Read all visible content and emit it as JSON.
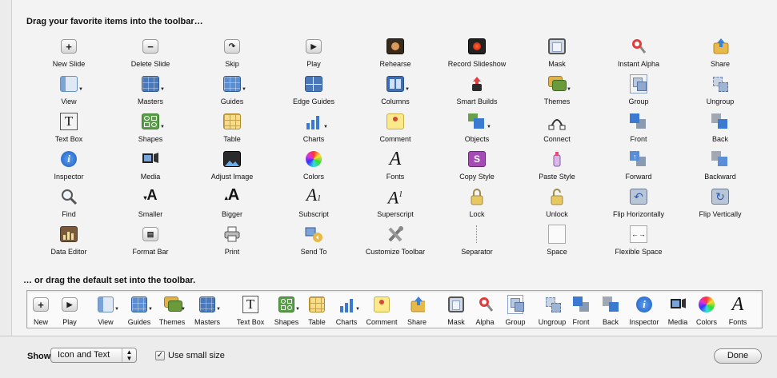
{
  "header": {
    "favorites_title": "Drag your favorite items into the toolbar…",
    "default_title": "… or drag the default set into the toolbar."
  },
  "items": [
    {
      "label": "New Slide",
      "icon": "plus-icon"
    },
    {
      "label": "Delete Slide",
      "icon": "minus-icon"
    },
    {
      "label": "Skip",
      "icon": "skip-icon"
    },
    {
      "label": "Play",
      "icon": "play-icon"
    },
    {
      "label": "Rehearse",
      "icon": "rehearse-icon"
    },
    {
      "label": "Record Slideshow",
      "icon": "record-icon"
    },
    {
      "label": "Mask",
      "icon": "mask-icon"
    },
    {
      "label": "Instant Alpha",
      "icon": "instant-alpha-icon"
    },
    {
      "label": "Share",
      "icon": "share-icon"
    },
    {
      "label": "View",
      "icon": "view-icon"
    },
    {
      "label": "Masters",
      "icon": "masters-icon"
    },
    {
      "label": "Guides",
      "icon": "guides-icon"
    },
    {
      "label": "Edge Guides",
      "icon": "edge-guides-icon"
    },
    {
      "label": "Columns",
      "icon": "columns-icon"
    },
    {
      "label": "Smart Builds",
      "icon": "smart-builds-icon"
    },
    {
      "label": "Themes",
      "icon": "themes-icon"
    },
    {
      "label": "Group",
      "icon": "group-icon"
    },
    {
      "label": "Ungroup",
      "icon": "ungroup-icon"
    },
    {
      "label": "Text Box",
      "icon": "text-box-icon"
    },
    {
      "label": "Shapes",
      "icon": "shapes-icon"
    },
    {
      "label": "Table",
      "icon": "table-icon"
    },
    {
      "label": "Charts",
      "icon": "charts-icon"
    },
    {
      "label": "Comment",
      "icon": "comment-icon"
    },
    {
      "label": "Objects",
      "icon": "objects-icon"
    },
    {
      "label": "Connect",
      "icon": "connect-icon"
    },
    {
      "label": "Front",
      "icon": "front-icon"
    },
    {
      "label": "Back",
      "icon": "back-icon"
    },
    {
      "label": "Inspector",
      "icon": "inspector-icon"
    },
    {
      "label": "Media",
      "icon": "media-icon"
    },
    {
      "label": "Adjust Image",
      "icon": "adjust-image-icon"
    },
    {
      "label": "Colors",
      "icon": "colors-icon"
    },
    {
      "label": "Fonts",
      "icon": "fonts-icon"
    },
    {
      "label": "Copy Style",
      "icon": "copy-style-icon"
    },
    {
      "label": "Paste Style",
      "icon": "paste-style-icon"
    },
    {
      "label": "Forward",
      "icon": "forward-icon"
    },
    {
      "label": "Backward",
      "icon": "backward-icon"
    },
    {
      "label": "Find",
      "icon": "find-icon"
    },
    {
      "label": "Smaller",
      "icon": "smaller-icon"
    },
    {
      "label": "Bigger",
      "icon": "bigger-icon"
    },
    {
      "label": "Subscript",
      "icon": "subscript-icon"
    },
    {
      "label": "Superscript",
      "icon": "superscript-icon"
    },
    {
      "label": "Lock",
      "icon": "lock-icon"
    },
    {
      "label": "Unlock",
      "icon": "unlock-icon"
    },
    {
      "label": "Flip Horizontally",
      "icon": "flip-horizontal-icon"
    },
    {
      "label": "Flip Vertically",
      "icon": "flip-vertical-icon"
    },
    {
      "label": "Data Editor",
      "icon": "data-editor-icon"
    },
    {
      "label": "Format Bar",
      "icon": "format-bar-icon"
    },
    {
      "label": "Print",
      "icon": "print-icon"
    },
    {
      "label": "Send To",
      "icon": "send-to-icon"
    },
    {
      "label": "Customize Toolbar",
      "icon": "customize-toolbar-icon"
    },
    {
      "label": "Separator",
      "icon": "separator-icon"
    },
    {
      "label": "Space",
      "icon": "space-icon"
    },
    {
      "label": "Flexible Space",
      "icon": "flexible-space-icon"
    }
  ],
  "default_set": [
    {
      "label": "New",
      "icon": "plus-icon"
    },
    {
      "label": "Play",
      "icon": "play-icon"
    },
    {
      "label": "View",
      "icon": "view-icon"
    },
    {
      "label": "Guides",
      "icon": "guides-icon"
    },
    {
      "label": "Themes",
      "icon": "themes-icon"
    },
    {
      "label": "Masters",
      "icon": "masters-icon"
    },
    {
      "label": "Text Box",
      "icon": "text-box-icon"
    },
    {
      "label": "Shapes",
      "icon": "shapes-icon"
    },
    {
      "label": "Table",
      "icon": "table-icon"
    },
    {
      "label": "Charts",
      "icon": "charts-icon"
    },
    {
      "label": "Comment",
      "icon": "comment-icon"
    },
    {
      "label": "Share",
      "icon": "share-icon"
    },
    {
      "label": "Mask",
      "icon": "mask-icon"
    },
    {
      "label": "Alpha",
      "icon": "instant-alpha-icon"
    },
    {
      "label": "Group",
      "icon": "group-icon"
    },
    {
      "label": "Ungroup",
      "icon": "ungroup-icon"
    },
    {
      "label": "Front",
      "icon": "front-icon"
    },
    {
      "label": "Back",
      "icon": "back-icon"
    },
    {
      "label": "Inspector",
      "icon": "inspector-icon"
    },
    {
      "label": "Media",
      "icon": "media-icon"
    },
    {
      "label": "Colors",
      "icon": "colors-icon"
    },
    {
      "label": "Fonts",
      "icon": "fonts-icon"
    }
  ],
  "footer": {
    "show_label": "Show",
    "show_value": "Icon and Text",
    "small_size_label": "Use small size",
    "small_size_checked": true,
    "done_label": "Done"
  },
  "colors": {
    "panel": "#f3f3f3",
    "accent_blue": "#4a78b8",
    "background": "#ececec"
  }
}
